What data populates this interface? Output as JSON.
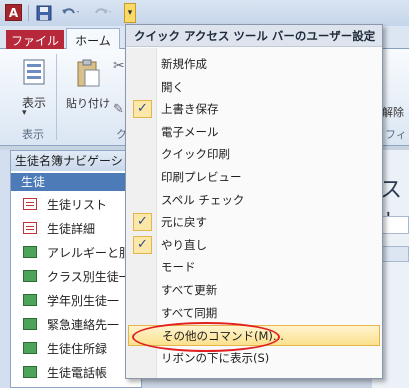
{
  "quick_access": {
    "logo": "A",
    "toggle_glyph": "▾"
  },
  "tabs": {
    "file": "ファイル",
    "home": "ホーム"
  },
  "ribbon": {
    "view_label": "表示",
    "paste_label": "貼り付け",
    "group_view": "表示",
    "group_clip": "ク",
    "right_fragment_1": "解除",
    "right_fragment_2": "ィフィル"
  },
  "nav": {
    "header": "生徒名簿ナビゲーショ",
    "group": "生徒",
    "items": [
      {
        "label": "生徒リスト",
        "type": "form"
      },
      {
        "label": "生徒詳細",
        "type": "form"
      },
      {
        "label": "アレルギーと服用",
        "type": "report"
      },
      {
        "label": "クラス別生徒一",
        "type": "report"
      },
      {
        "label": "学年別生徒一",
        "type": "report"
      },
      {
        "label": "緊急連絡先一",
        "type": "report"
      },
      {
        "label": "生徒住所録",
        "type": "report"
      },
      {
        "label": "生徒電話帳",
        "type": "report"
      }
    ]
  },
  "right_doc": {
    "big_text": "スト"
  },
  "menu": {
    "title": "クイック アクセス ツール バーのユーザー設定",
    "items": [
      {
        "label": "新規作成",
        "checked": false
      },
      {
        "label": "開く",
        "checked": false
      },
      {
        "label": "上書き保存",
        "checked": true
      },
      {
        "label": "電子メール",
        "checked": false
      },
      {
        "label": "クイック印刷",
        "checked": false
      },
      {
        "label": "印刷プレビュー",
        "checked": false
      },
      {
        "label": "スペル チェック",
        "checked": false
      },
      {
        "label": "元に戻す",
        "checked": true
      },
      {
        "label": "やり直し",
        "checked": true
      },
      {
        "label": "モード",
        "checked": false
      },
      {
        "label": "すべて更新",
        "checked": false
      },
      {
        "label": "すべて同期",
        "checked": false
      },
      {
        "label": "その他のコマンド(M)...",
        "checked": false,
        "highlighted": true
      },
      {
        "label": "リボンの下に表示(S)",
        "checked": false
      }
    ],
    "check_glyph": "✓"
  }
}
